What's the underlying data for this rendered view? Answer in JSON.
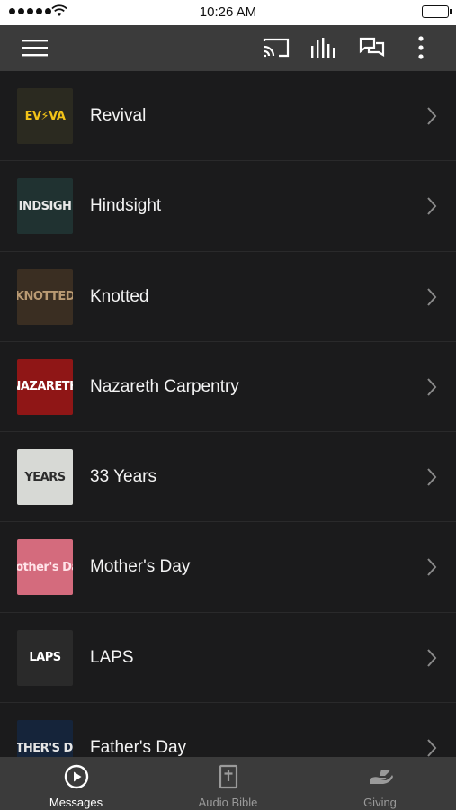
{
  "status": {
    "time": "10:26 AM"
  },
  "toolbar": {
    "icons": [
      "menu-icon",
      "cast-icon",
      "audio-bars-icon",
      "chat-icon",
      "more-vert-icon"
    ]
  },
  "series": [
    {
      "title": "Revival",
      "thumb_text": "EV⚡VA",
      "thumb_bg": "#2b2a20",
      "thumb_fg": "#f2c318"
    },
    {
      "title": "Hindsight",
      "thumb_text": "INDSIGH",
      "thumb_bg": "#203231",
      "thumb_fg": "#e8e8e8"
    },
    {
      "title": "Knotted",
      "thumb_text": "KNOTTED",
      "thumb_bg": "#3a2e22",
      "thumb_fg": "#b99a73"
    },
    {
      "title": "Nazareth Carpentry",
      "thumb_text": "NAZARETH",
      "thumb_bg": "#8f1616",
      "thumb_fg": "#ffffff"
    },
    {
      "title": "33 Years",
      "thumb_text": "YEARS",
      "thumb_bg": "#d7d9d5",
      "thumb_fg": "#2d2d2d"
    },
    {
      "title": "Mother's Day",
      "thumb_text": "Mother's Day",
      "thumb_bg": "#d46b7d",
      "thumb_fg": "#ffe3e8"
    },
    {
      "title": "LAPS",
      "thumb_text": "LAPS",
      "thumb_bg": "#2a2a2a",
      "thumb_fg": "#ffffff"
    },
    {
      "title": "Father's Day",
      "thumb_text": "FATHER'S DAY",
      "thumb_bg": "#15243a",
      "thumb_fg": "#e6e6e6"
    }
  ],
  "tabs": [
    {
      "label": "Messages",
      "icon": "play-circle-icon",
      "active": true,
      "color": "#ffffff"
    },
    {
      "label": "Audio Bible",
      "icon": "bible-icon",
      "active": false,
      "color": "#9a9a9a"
    },
    {
      "label": "Giving",
      "icon": "giving-hand-icon",
      "active": false,
      "color": "#9a9a9a"
    }
  ],
  "colors": {
    "bar": "#3b3b3b",
    "list_bg": "#1b1b1c",
    "divider": "#2a2a2b",
    "chevron": "#8a8a8a"
  }
}
